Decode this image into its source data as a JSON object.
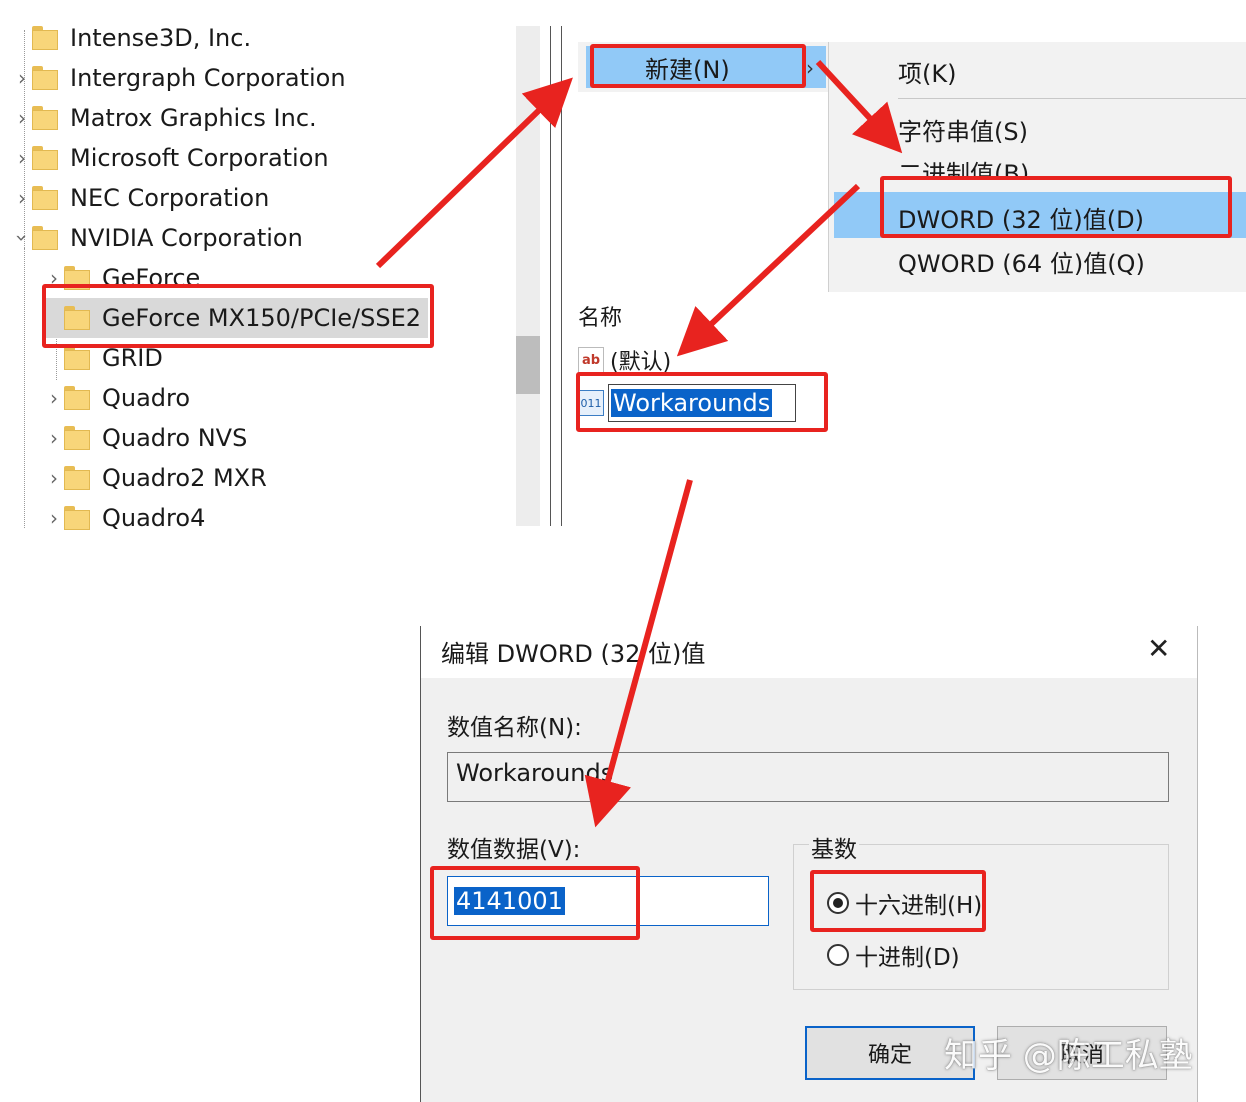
{
  "tree": {
    "items": [
      {
        "label": "Intense3D, Inc.",
        "level": 0,
        "expander": ""
      },
      {
        "label": "Intergraph Corporation",
        "level": 0,
        "expander": "chevron-right"
      },
      {
        "label": "Matrox Graphics Inc.",
        "level": 0,
        "expander": "chevron-right"
      },
      {
        "label": "Microsoft Corporation",
        "level": 0,
        "expander": "chevron-right"
      },
      {
        "label": "NEC Corporation",
        "level": 0,
        "expander": "chevron-right"
      },
      {
        "label": "NVIDIA Corporation",
        "level": 0,
        "expander": "chevron-down"
      },
      {
        "label": "GeForce",
        "level": 1,
        "expander": "chevron-right"
      },
      {
        "label": "GeForce MX150/PCIe/SSE2",
        "level": 1,
        "expander": "",
        "selected": true
      },
      {
        "label": "GRID",
        "level": 1,
        "expander": ""
      },
      {
        "label": "Quadro",
        "level": 1,
        "expander": "chevron-right"
      },
      {
        "label": "Quadro NVS",
        "level": 1,
        "expander": "chevron-right"
      },
      {
        "label": "Quadro2 MXR",
        "level": 1,
        "expander": "chevron-right"
      },
      {
        "label": "Quadro4",
        "level": 1,
        "expander": "chevron-right"
      }
    ]
  },
  "context_menu": {
    "new_label": "新建(N)",
    "submenu": {
      "key": "项(K)",
      "string": "字符串值(S)",
      "binary": "二进制值(B)",
      "dword": "DWORD (32 位)值(D)",
      "qword": "QWORD (64 位)值(Q)"
    }
  },
  "values_pane": {
    "column_name": "名称",
    "default_value": "(默认)",
    "new_value_name": "Workarounds"
  },
  "dialog": {
    "title": "编辑 DWORD (32 位)值",
    "name_label": "数值名称(N):",
    "name_value": "Workarounds",
    "data_label": "数值数据(V):",
    "data_value": "4141001",
    "base_label": "基数",
    "base_options": [
      "十六进制(H)",
      "十进制(D)"
    ],
    "base_selected": "十六进制(H)",
    "ok_label": "确定",
    "cancel_label": "取消"
  },
  "watermark": "知乎 @陈工私塾",
  "colors": {
    "highlight": "#91c9f7",
    "selection": "#0a63c9",
    "annotation": "#e8231f",
    "folder": "#f8d67a"
  }
}
